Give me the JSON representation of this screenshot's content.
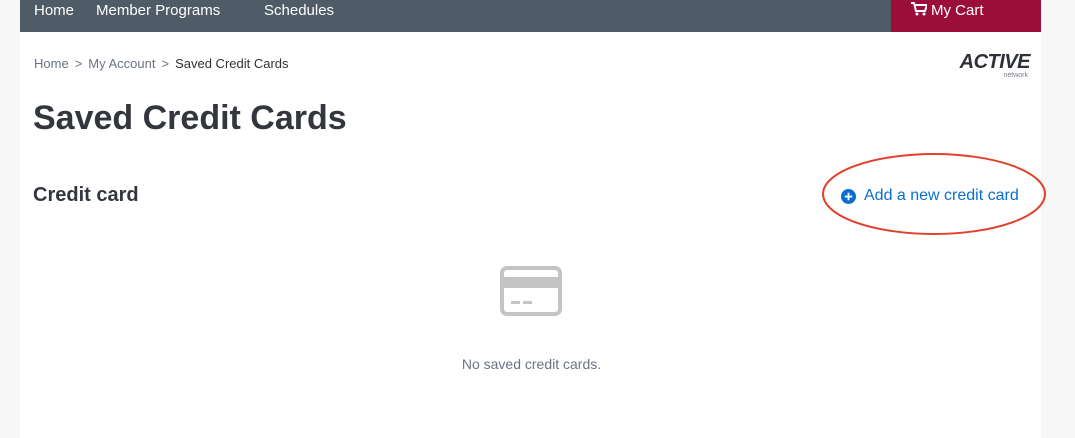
{
  "nav": {
    "items": [
      "Home",
      "Member Programs",
      "Schedules"
    ],
    "cart_label": "My Cart"
  },
  "breadcrumb": {
    "items": [
      "Home",
      "My Account",
      "Saved Credit Cards"
    ],
    "separator": ">"
  },
  "logo": {
    "main": "ACTIVE",
    "sub": "network"
  },
  "page": {
    "title": "Saved Credit Cards",
    "section_title": "Credit card",
    "add_card_label": "Add a new credit card",
    "empty_message": "No saved credit cards."
  },
  "colors": {
    "nav_bg": "#4f5b66",
    "cart_bg": "#9b0e3b",
    "link": "#0a6ed1",
    "annotation": "#e0402c",
    "icon_gray": "#c4c4c4"
  },
  "icons": {
    "cart": "cart-icon",
    "add": "plus-circle-icon",
    "card": "credit-card-icon"
  }
}
